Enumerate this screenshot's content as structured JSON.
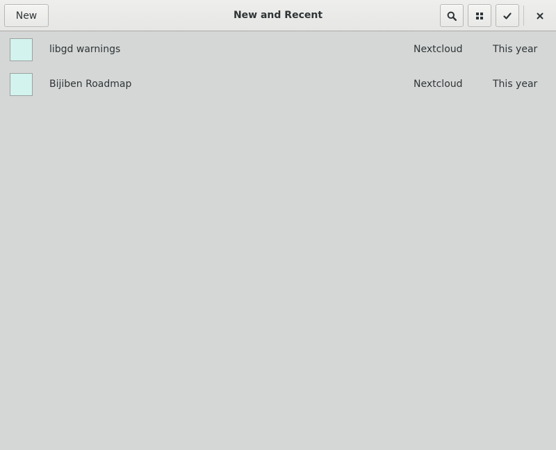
{
  "header": {
    "new_label": "New",
    "title": "New and Recent",
    "icons": {
      "search": "search-icon",
      "view": "grid-view-icon",
      "select": "checkmark-icon",
      "close": "close-icon"
    }
  },
  "documents": [
    {
      "name": "libgd warnings",
      "source": "Nextcloud",
      "date": "This year"
    },
    {
      "name": "Bijiben Roadmap",
      "source": "Nextcloud",
      "date": "This year"
    }
  ],
  "colors": {
    "background": "#d5d7d6",
    "thumbnail": "#d2f3ee"
  }
}
